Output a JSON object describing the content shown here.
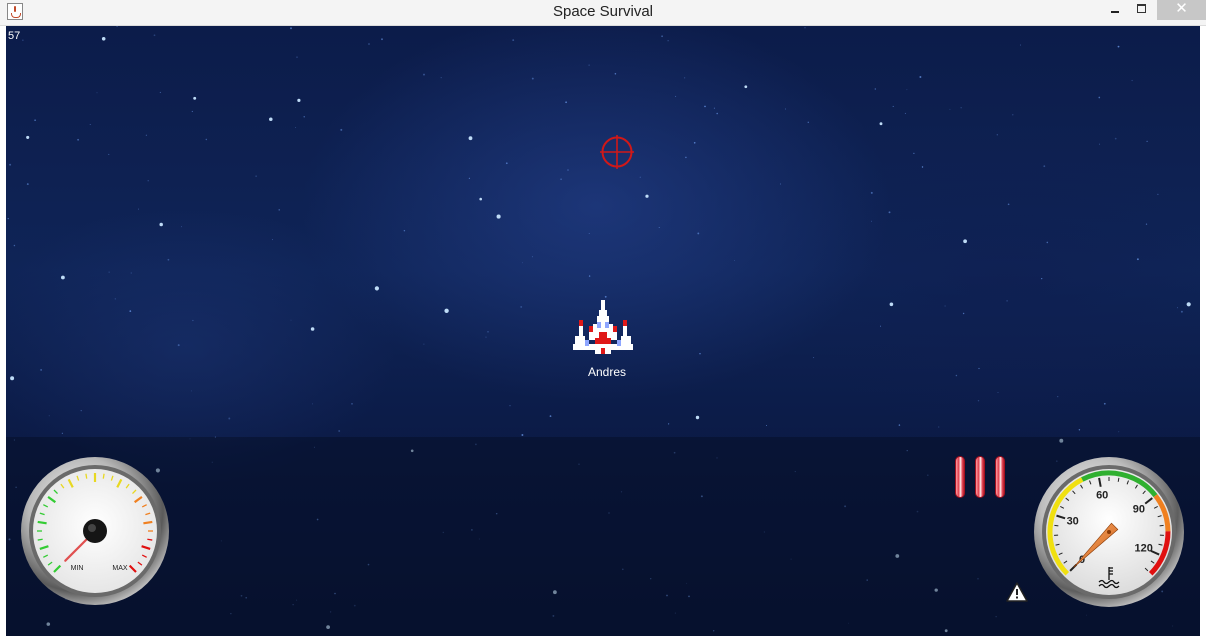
{
  "window": {
    "title": "Space Survival",
    "controls": {
      "minimize": "minimize",
      "maximize": "maximize",
      "close": "✕"
    }
  },
  "hud": {
    "fps": "57",
    "player_name": "Andres",
    "left_gauge": {
      "min_label": "MIN",
      "max_label": "MAX",
      "level": 0.0
    },
    "right_gauge": {
      "ticks": [
        "0",
        "30",
        "60",
        "90",
        "120"
      ],
      "value": 0
    },
    "ammo_bars": 3,
    "icons": {
      "crosshair": "crosshair-icon",
      "ship": "spaceship-icon",
      "warning": "warning-icon",
      "thermometer": "thermometer-icon"
    }
  },
  "colors": {
    "space": "#0f2457",
    "crosshair": "#d01818",
    "needle_left": "#e05050",
    "needle_right": "#e07018",
    "ammo": "#e24050"
  }
}
